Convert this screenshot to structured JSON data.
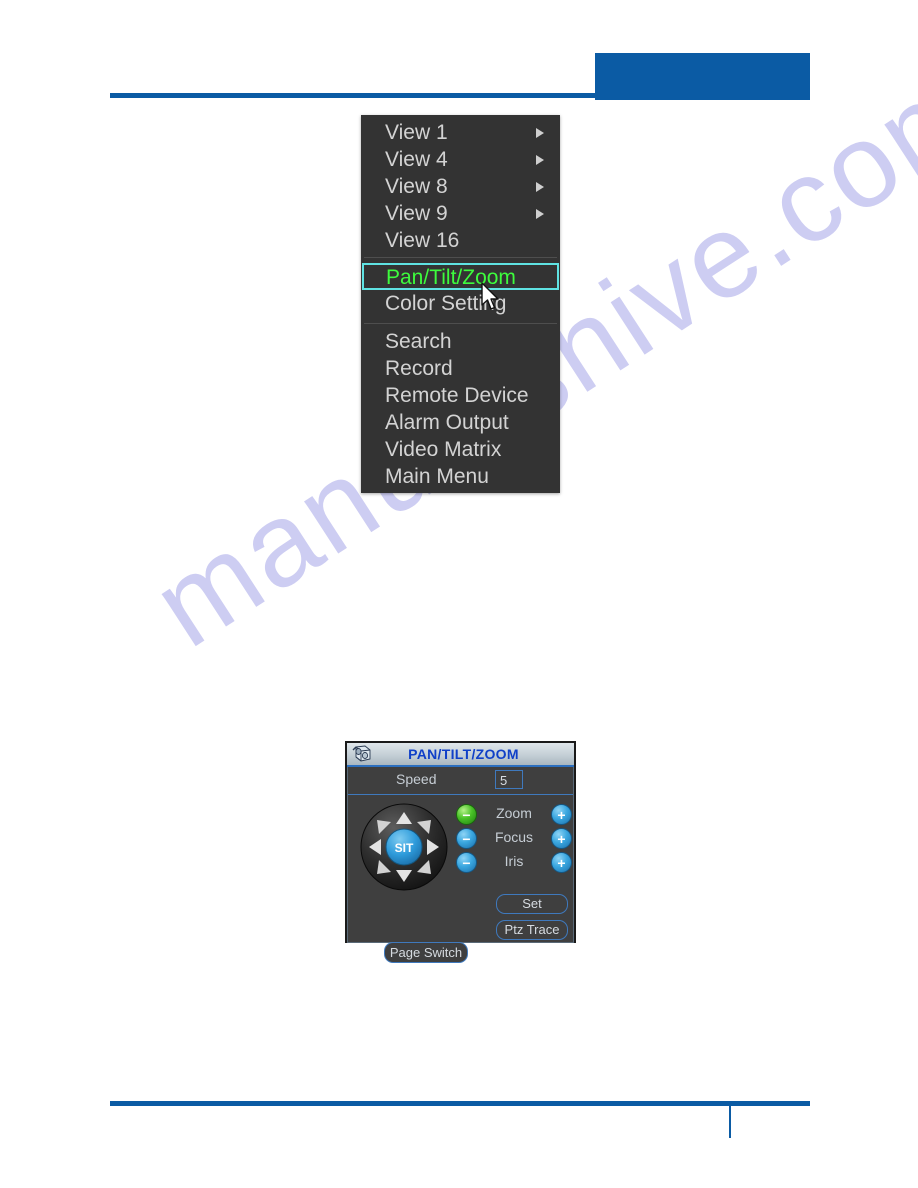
{
  "page": {
    "watermark_text": "manualshive.com",
    "accent_color": "#0b5ba4"
  },
  "context_menu": {
    "name": "right-click-preview-menu",
    "background_color": "#333333",
    "text_color": "#d3d3d3",
    "selected_text_color": "#3dfb3d",
    "selected_border_color": "#5fe3e3",
    "groups": [
      {
        "items": [
          {
            "label": "View 1",
            "has_submenu": true,
            "selected": false
          },
          {
            "label": "View 4",
            "has_submenu": true,
            "selected": false
          },
          {
            "label": "View 8",
            "has_submenu": true,
            "selected": false
          },
          {
            "label": "View 9",
            "has_submenu": true,
            "selected": false
          },
          {
            "label": "View 16",
            "has_submenu": false,
            "selected": false
          }
        ]
      },
      {
        "items": [
          {
            "label": "Pan/Tilt/Zoom",
            "has_submenu": false,
            "selected": true
          },
          {
            "label": "Color Setting",
            "has_submenu": false,
            "selected": false
          }
        ]
      },
      {
        "items": [
          {
            "label": "Search",
            "has_submenu": false,
            "selected": false
          },
          {
            "label": "Record",
            "has_submenu": false,
            "selected": false
          },
          {
            "label": "Remote Device",
            "has_submenu": false,
            "selected": false
          },
          {
            "label": "Alarm Output",
            "has_submenu": false,
            "selected": false
          },
          {
            "label": "Video Matrix",
            "has_submenu": false,
            "selected": false
          },
          {
            "label": "Main Menu",
            "has_submenu": false,
            "selected": false
          }
        ]
      }
    ]
  },
  "ptz_panel": {
    "title": "PAN/TILT/ZOOM",
    "title_color": "#1040c8",
    "speed": {
      "label": "Speed",
      "value": "5"
    },
    "dpad": {
      "center_label": "SIT",
      "center_color": "#2e9bdb"
    },
    "lens_controls": [
      {
        "label": "Zoom",
        "minus_color": "#49c227",
        "plus_color": "#3aa7e0",
        "minus_sign": "−",
        "plus_sign": "+"
      },
      {
        "label": "Focus",
        "minus_color": "#3aa7e0",
        "plus_color": "#3aa7e0",
        "minus_sign": "−",
        "plus_sign": "+"
      },
      {
        "label": "Iris",
        "minus_color": "#3aa7e0",
        "plus_color": "#3aa7e0",
        "minus_sign": "−",
        "plus_sign": "+"
      }
    ],
    "buttons": {
      "set": "Set",
      "ptz_trace": "Ptz Trace",
      "page_switch": "Page Switch"
    }
  }
}
